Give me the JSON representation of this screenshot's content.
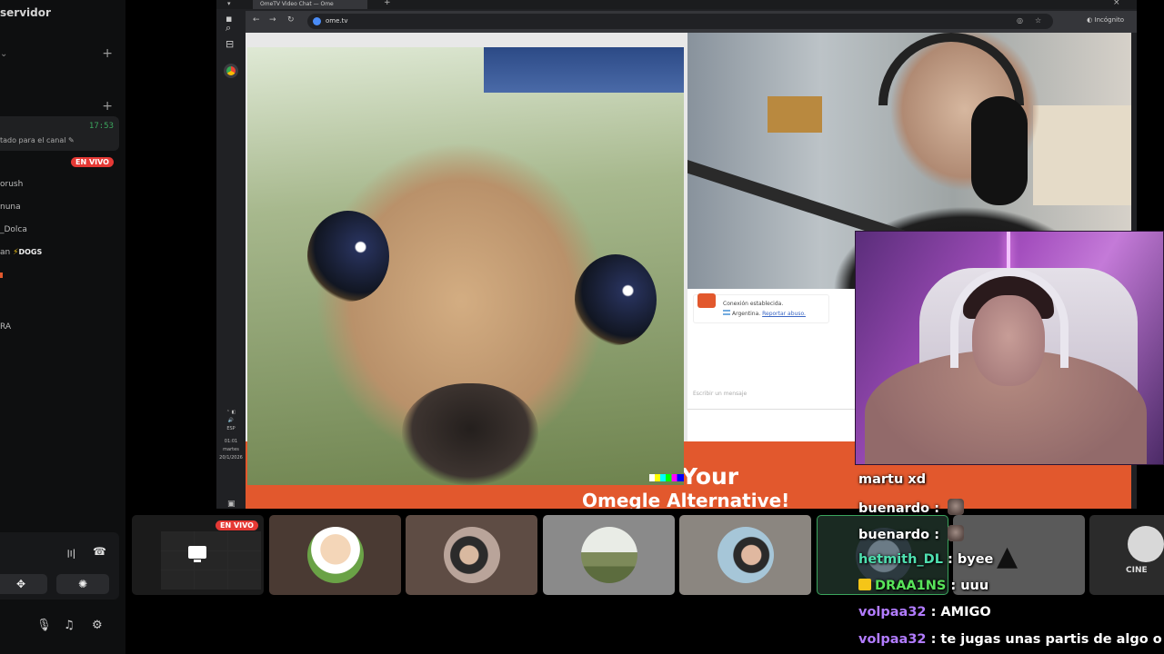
{
  "sidebar": {
    "server_title": "servidor",
    "status_time": "17:53",
    "status_text": "tado para el canal",
    "live_badge": "EN VIVO",
    "items": [
      "orush",
      "nuna",
      "_Dolca",
      "an",
      "RA"
    ],
    "dogs_label": "DOGS"
  },
  "browser": {
    "tab_title": "OmeTV Video Chat — Ome",
    "url": "ome.tv",
    "incognito_label": "Incógnito",
    "tray_lang": "ESP",
    "tray_time": "01:01",
    "tray_day": "martes",
    "tray_date": "20/1/2026"
  },
  "ome": {
    "connection_text": "Conexión establecida.",
    "country": "Argentina.",
    "report_link": "Reportar abuso.",
    "input_placeholder": "Escribir un mensaje",
    "promo_line1": "o Chat with OmeTV  Your",
    "promo_line2": "Omegle Alternative!"
  },
  "tiles": {
    "live_badge": "EN VIVO",
    "cine_label": "CINE"
  },
  "stream_chat": [
    {
      "user": "martu",
      "sep": "",
      "text": "xd",
      "color": "#ffffff",
      "badge": false,
      "emote": false
    },
    {
      "user": "buenardo",
      "sep": " : ",
      "text": "",
      "color": "#ffffff",
      "badge": false,
      "emote": true
    },
    {
      "user": "buenardo",
      "sep": " : ",
      "text": "",
      "color": "#ffffff",
      "badge": false,
      "emote": true
    },
    {
      "user": "hetmith_DL",
      "sep": " : ",
      "text": "byee",
      "color": "#4fe0b0",
      "badge": false,
      "emote": false
    },
    {
      "user": "DRAA1NS",
      "sep": " : ",
      "text": "uuu",
      "color": "#58e35a",
      "badge": true,
      "emote": false
    },
    {
      "user": "volpaa32",
      "sep": " : ",
      "text": "AMIGO",
      "color": "#b27cff",
      "badge": false,
      "emote": false
    },
    {
      "user": "volpaa32",
      "sep": " : ",
      "text": "te jugas unas partis de algo o no",
      "color": "#b27cff",
      "badge": false,
      "emote": false
    }
  ],
  "colors": {
    "omegle_orange": "#e2582d",
    "live_red": "#e53935",
    "discord_green": "#3ba55d"
  }
}
